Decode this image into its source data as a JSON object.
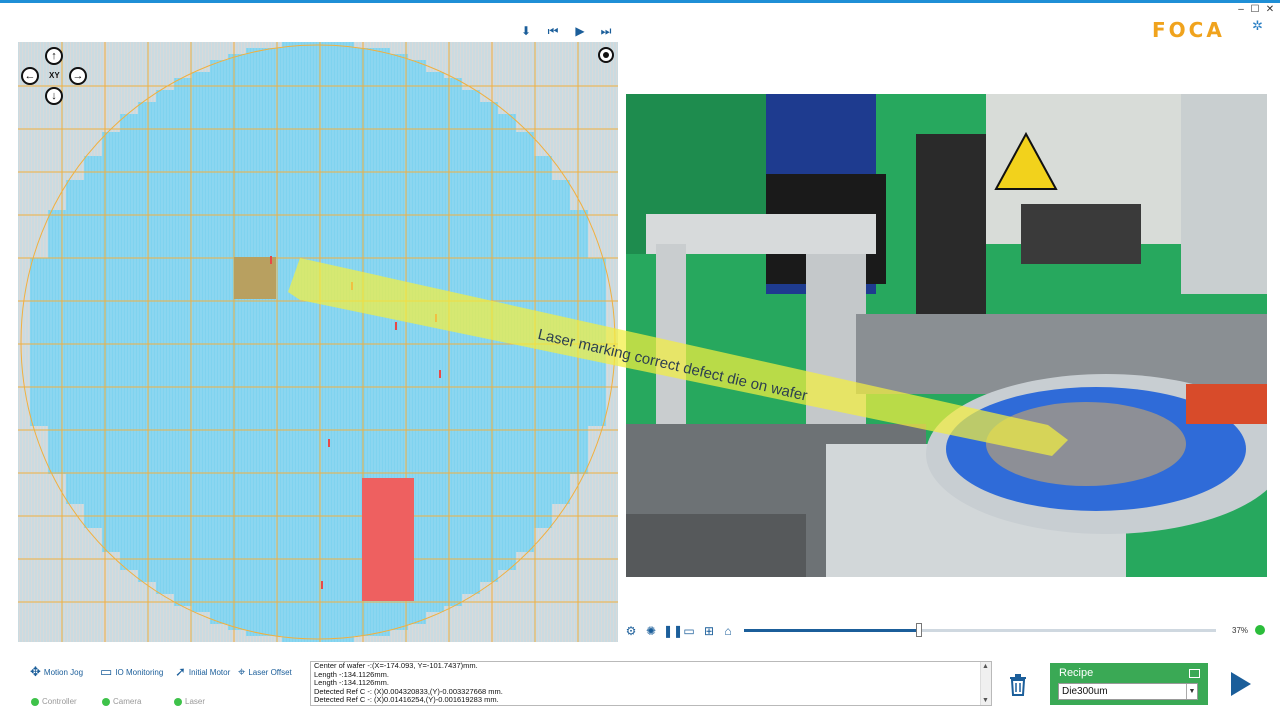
{
  "window": {
    "minimize_glyph": "–",
    "maximize_glyph": "☐",
    "close_glyph": "✕"
  },
  "brand": {
    "logo_text": "FOCA",
    "logo_icon": "gear-icon"
  },
  "wafer_toolbar": {
    "buttons": [
      {
        "name": "download-icon",
        "glyph": "⬇"
      },
      {
        "name": "skip-back-icon",
        "glyph": "⏮"
      },
      {
        "name": "play-icon",
        "glyph": "▶"
      },
      {
        "name": "skip-forward-icon",
        "glyph": "⏭"
      }
    ]
  },
  "wafer_nav": {
    "xy_label": "XY",
    "up_glyph": "↑",
    "down_glyph": "↓",
    "left_glyph": "←",
    "right_glyph": "→"
  },
  "annotation": {
    "text": "Laser marking correct defect die on wafer"
  },
  "colors": {
    "die_cyan": "#7fd3ef",
    "grid_orange": "#f0b040",
    "defect_red": "#ee6060",
    "selected_brown": "#b8a060",
    "accent_blue": "#1b5e9a",
    "recipe_green": "#3aa955",
    "annotation_yellow": "#f2ef40"
  },
  "video_controls": {
    "icons": [
      "settings-icon",
      "aperture-icon",
      "pause-icon",
      "monitor-icon",
      "grid-icon",
      "home-icon"
    ],
    "progress_fraction": 0.37,
    "zoom_text": "37%"
  },
  "bottom_toolbar": [
    {
      "label": "Motion Jog",
      "icon": "motion-jog-icon"
    },
    {
      "label": "IO Monitoring",
      "icon": "monitor-icon"
    },
    {
      "label": "Initial Motor",
      "icon": "arrow-icon"
    },
    {
      "label": "Laser Offset",
      "icon": "crosshair-icon"
    }
  ],
  "status": [
    {
      "label": "Controller"
    },
    {
      "label": "Camera"
    },
    {
      "label": "Laser"
    }
  ],
  "log": {
    "lines": [
      "Center of wafer -:(X=-174.093, Y=-101.7437)mm.",
      "Length -:134.1126mm.",
      "Length -:134.1126mm.",
      "Detected Ref C -: (X)0.004320833,(Y)-0.003327668 mm.",
      "Detected Ref C -: (X)0.01416254,(Y)-0.001619283 mm."
    ]
  },
  "recipe": {
    "label": "Recipe",
    "value": "Die300um"
  }
}
